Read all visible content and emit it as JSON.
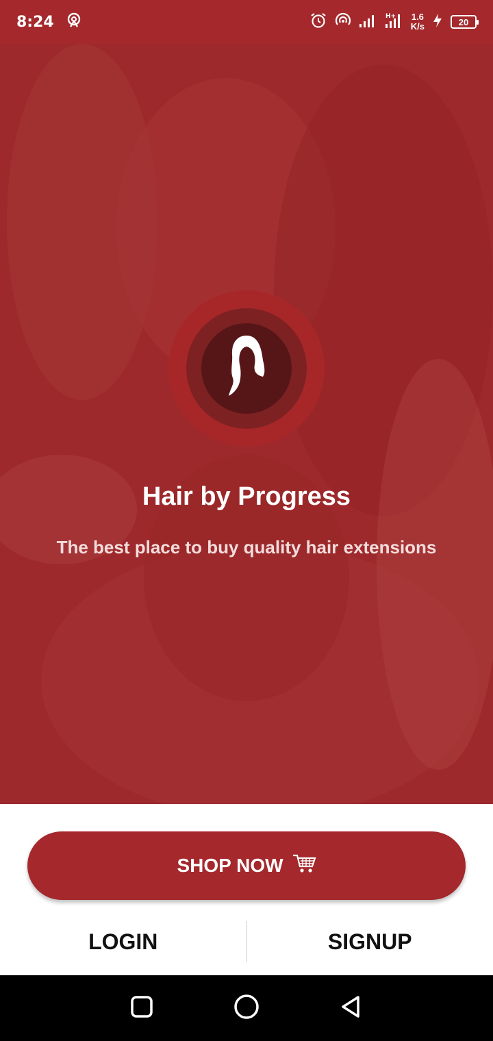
{
  "status_bar": {
    "time": "8:24",
    "speed_value": "1.6",
    "speed_unit": "K/s",
    "battery": "20"
  },
  "hero": {
    "title": "Hair by Progress",
    "subtitle": "The best place to buy quality hair extensions",
    "overlay_color": "#a4282c"
  },
  "actions": {
    "shop_now_label": "SHOP NOW",
    "login_label": "LOGIN",
    "signup_label": "SIGNUP"
  },
  "icons": {
    "logo": "woman-hair-silhouette-icon",
    "cart": "shopping-cart-icon",
    "nav_recents": "square-icon",
    "nav_home": "circle-icon",
    "nav_back": "triangle-back-icon"
  },
  "colors": {
    "primary": "#a4282c",
    "text_dark": "#111111",
    "background": "#ffffff"
  }
}
